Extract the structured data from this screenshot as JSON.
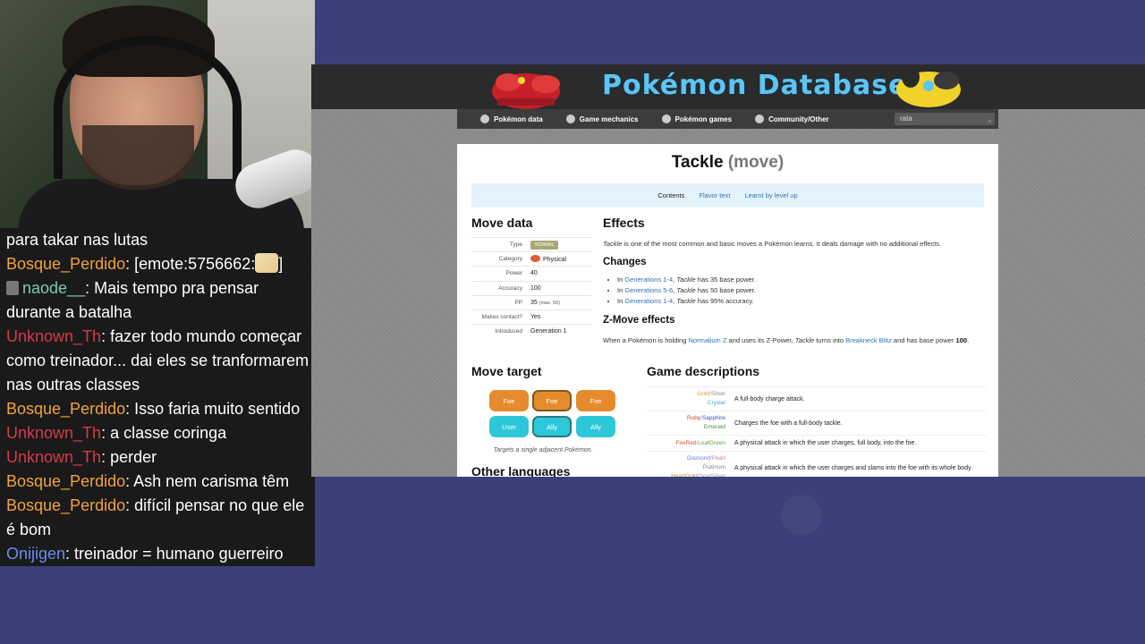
{
  "chat": {
    "lines": [
      {
        "user": "",
        "user_color": "",
        "text": "para takar nas lutas"
      },
      {
        "user": "Bosque_Perdido",
        "user_color": "#f2a33a",
        "text": ": [emote:5756662:"
      },
      {
        "user": "naode__",
        "user_color": "#7fc7b3",
        "text": ": Mais tempo pra pensar durante a batalha"
      },
      {
        "user": "Unknown_Th",
        "user_color": "#d43b4a",
        "text": ": fazer todo mundo começar como treinador... dai eles se tranformarem nas outras classes"
      },
      {
        "user": "Bosque_Perdido",
        "user_color": "#f2a33a",
        "text": ": Isso faria muito sentido"
      },
      {
        "user": "Unknown_Th",
        "user_color": "#d43b4a",
        "text": ": a classe coringa"
      },
      {
        "user": "Unknown_Th",
        "user_color": "#d43b4a",
        "text": ": perder"
      },
      {
        "user": "Bosque_Perdido",
        "user_color": "#f2a33a",
        "text": ": Ash nem carisma têm"
      },
      {
        "user": "Bosque_Perdido",
        "user_color": "#f2a33a",
        "text": ": difícil pensar no que ele é bom"
      },
      {
        "user": "Onijigen",
        "user_color": "#6c8cf0",
        "text": ": treinador = humano guerreiro"
      }
    ],
    "emote_suffix": "]"
  },
  "site": {
    "title": "Pokémon Database",
    "nav": [
      "Pokémon data",
      "Game mechanics",
      "Pokémon games",
      "Community/Other"
    ],
    "search_value": "rata"
  },
  "move": {
    "name": "Tackle",
    "suffix": "(move)",
    "toc": {
      "current": "Contents",
      "links": [
        "Flavor text",
        "Learnt by level up"
      ]
    },
    "move_data_heading": "Move data",
    "rows": [
      {
        "k": "Type",
        "v": "NORMAL"
      },
      {
        "k": "Category",
        "v": "Physical"
      },
      {
        "k": "Power",
        "v": "40"
      },
      {
        "k": "Accuracy",
        "v": "100"
      },
      {
        "k": "PP",
        "v": "35",
        "extra": "(max. 56)"
      },
      {
        "k": "Makes contact?",
        "v": "Yes"
      },
      {
        "k": "Introduced",
        "v": "Generation 1"
      }
    ],
    "effects_heading": "Effects",
    "effects_name": "Tackle",
    "effects_text": " is one of the most common and basic moves a Pokémon learns. It deals damage with no additional effects.",
    "changes_heading": "Changes",
    "changes": [
      {
        "pre": "In ",
        "link": "Generations 1-4",
        "mid": ", ",
        "it": "Tackle",
        "post": " has 35 base power."
      },
      {
        "pre": "In ",
        "link": "Generations 5-6",
        "mid": ", ",
        "it": "Tackle",
        "post": " has 50 base power."
      },
      {
        "pre": "In ",
        "link": "Generations 1-4",
        "mid": ", ",
        "it": "Tackle",
        "post": " has 95% accuracy."
      }
    ],
    "zmove_heading": "Z-Move effects",
    "zmove": {
      "a": "When a Pokémon is holding ",
      "link1": "Normalium Z",
      "b": " and uses its Z-Power, ",
      "it": "Tackle",
      "c": " turns into ",
      "link2": "Breakneck Blitz",
      "d": " and has base power ",
      "power": "100",
      "e": "."
    },
    "target_heading": "Move target",
    "targets_top": [
      "Foe",
      "Foe",
      "Foe"
    ],
    "targets_bottom": [
      "User",
      "Ally",
      "Ally"
    ],
    "target_caption": "Targets a single adjacent Pokémon.",
    "other_languages_heading": "Other languages",
    "game_desc_heading": "Game descriptions",
    "game_desc": [
      {
        "versions": [
          [
            "Gold",
            "c-gold"
          ],
          [
            "/",
            "sep"
          ],
          [
            "Silver",
            "c-silver"
          ],
          [
            "\n",
            ""
          ],
          [
            "Crystal",
            "c-crystal"
          ]
        ],
        "text": "A full-body charge attack."
      },
      {
        "versions": [
          [
            "Ruby",
            "c-ruby"
          ],
          [
            "/",
            "sep"
          ],
          [
            "Sapphire",
            "c-sapphire"
          ],
          [
            "\n",
            ""
          ],
          [
            "Emerald",
            "c-emerald"
          ]
        ],
        "text": "Charges the foe with a full-body tackle."
      },
      {
        "versions": [
          [
            "FireRed",
            "c-firered"
          ],
          [
            "/",
            "sep"
          ],
          [
            "LeafGreen",
            "c-leafgreen"
          ]
        ],
        "text": "A physical attack in which the user charges, full body, into the foe."
      },
      {
        "versions": [
          [
            "Diamond",
            "c-diamond"
          ],
          [
            "/",
            "sep"
          ],
          [
            "Pearl",
            "c-pearl"
          ],
          [
            "\n",
            ""
          ],
          [
            "Platinum",
            "c-platinum"
          ],
          [
            "\n",
            ""
          ],
          [
            "HeartGold",
            "c-hg"
          ],
          [
            "/",
            "sep"
          ],
          [
            "SoulSilver",
            "c-ss"
          ]
        ],
        "text": "A physical attack in which the user charges and slams into the foe with its whole body."
      }
    ]
  }
}
